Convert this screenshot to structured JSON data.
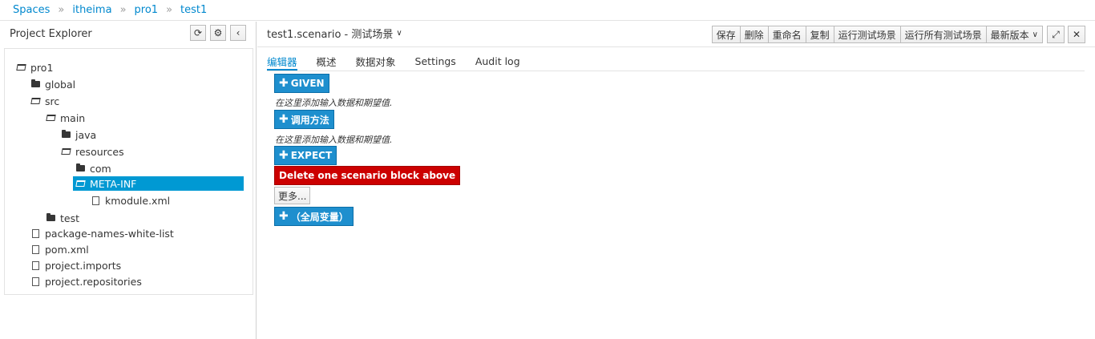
{
  "breadcrumb": {
    "items": [
      "Spaces",
      "itheima",
      "pro1",
      "test1"
    ],
    "separator": "»"
  },
  "explorer": {
    "title": "Project Explorer",
    "buttons": {
      "refresh": "⟳",
      "settings": "⚙",
      "collapse": "‹"
    },
    "tree": [
      {
        "label": "pro1",
        "type": "folder-open"
      },
      {
        "label": "global",
        "type": "folder"
      },
      {
        "label": "src",
        "type": "folder-open"
      },
      {
        "label": "main",
        "type": "folder-open"
      },
      {
        "label": "java",
        "type": "folder"
      },
      {
        "label": "resources",
        "type": "folder-open"
      },
      {
        "label": "com",
        "type": "folder"
      },
      {
        "label": "META-INF",
        "type": "folder-open",
        "selected": true
      },
      {
        "label": "kmodule.xml",
        "type": "file"
      },
      {
        "label": "test",
        "type": "folder"
      },
      {
        "label": "package-names-white-list",
        "type": "file"
      },
      {
        "label": "pom.xml",
        "type": "file"
      },
      {
        "label": "project.imports",
        "type": "file"
      },
      {
        "label": "project.repositories",
        "type": "file"
      }
    ]
  },
  "editor": {
    "title": "test1.scenario - 测试场景",
    "toolbar": {
      "save": "保存",
      "delete": "删除",
      "rename": "重命名",
      "copy": "复制",
      "run_scenario": "运行测试场景",
      "run_all": "运行所有测试场景",
      "latest_version": "最新版本"
    },
    "tabs": [
      "编辑器",
      "概述",
      "数据对象",
      "Settings",
      "Audit log"
    ],
    "active_tab": 0,
    "blocks": {
      "given": "GIVEN",
      "given_hint": "在这里添加输入数据和期望值.",
      "call_method": "调用方法",
      "call_hint": "在这里添加输入数据和期望值.",
      "expect": "EXPECT",
      "delete_block": "Delete one scenario block above",
      "more": "更多...",
      "global_vars": "（全局变量）"
    }
  },
  "colors": {
    "accent": "#0088ce",
    "button_blue": "#1e8fce",
    "danger": "#cc0000",
    "selection": "#0099d3"
  }
}
